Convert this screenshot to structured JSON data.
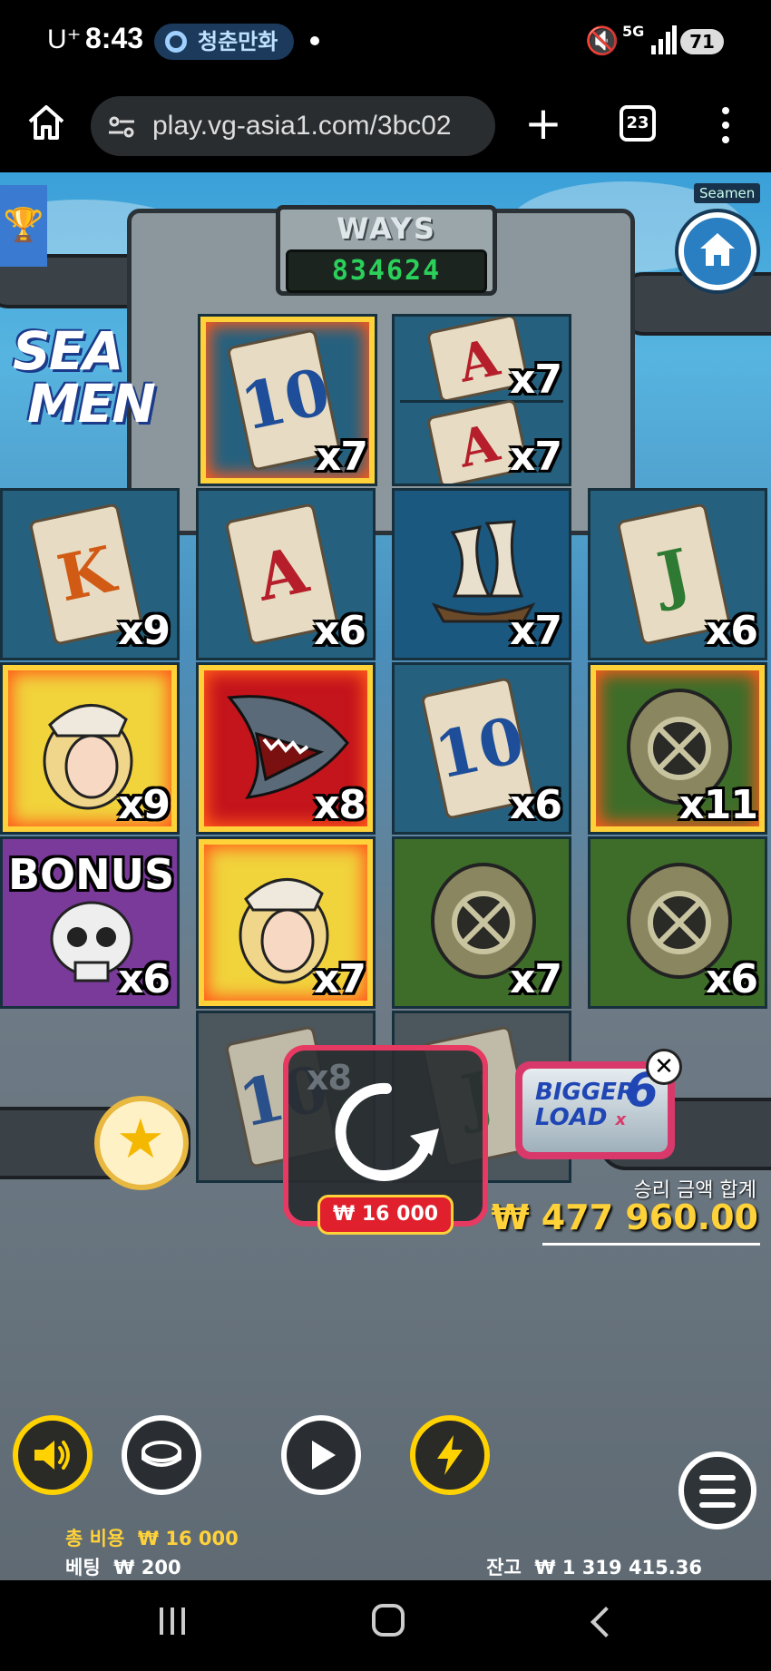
{
  "status_bar": {
    "carrier": "U⁺",
    "time": "8:43",
    "notification_app": "청춘만화",
    "network": "5G",
    "battery": "71"
  },
  "browser": {
    "url": "play.vg-asia1.com/3bc02",
    "tab_count": "23"
  },
  "game": {
    "tag": "Seamen",
    "logo_line1": "SEA",
    "logo_line2": "MEN",
    "ways_label": "WAYS",
    "ways_value": "834624",
    "reels": [
      {
        "symbol": "10",
        "mult": "x7",
        "win": true
      },
      {
        "symbol": "A",
        "mult_top": "x7",
        "mult": "x7"
      },
      {
        "symbol": "K",
        "mult": "x9"
      },
      {
        "symbol": "A",
        "mult": "x6"
      },
      {
        "symbol": "ship",
        "mult": "x7"
      },
      {
        "symbol": "J",
        "mult": "x6"
      },
      {
        "symbol": "sailor",
        "mult": "x9",
        "win": true
      },
      {
        "symbol": "shark",
        "mult": "x8",
        "win": true
      },
      {
        "symbol": "10",
        "mult": "x6"
      },
      {
        "symbol": "diving-helmet",
        "mult": "x11",
        "win": true
      },
      {
        "symbol": "bonus-skull",
        "label": "BONUS",
        "mult": "x6"
      },
      {
        "symbol": "sailor",
        "mult": "x7",
        "win": true
      },
      {
        "symbol": "diving-helmet",
        "mult": "x7"
      },
      {
        "symbol": "diving-helmet",
        "mult": "x6"
      },
      {
        "symbol": "10",
        "mult": "x8"
      },
      {
        "symbol": "J"
      }
    ],
    "spin_cost": "₩ 16 000",
    "bigger_load_line1": "BIGGER",
    "bigger_load_line2": "LOAD",
    "bigger_load_x": "x",
    "bigger_load_mult": "6",
    "win_total_label": "승리 금액 합계",
    "win_total_value": "₩ 477 960.00",
    "total_cost_label": "총 비용",
    "total_cost_value": "₩ 16 000",
    "bet_label": "베팅",
    "bet_value": "₩ 200",
    "balance_label": "잔고",
    "balance_value": "₩ 1 319 415.36"
  },
  "colors": {
    "accent_yellow": "#ffd23a",
    "spin_frame": "#e63a62",
    "ways_digits": "#2bd05a"
  }
}
